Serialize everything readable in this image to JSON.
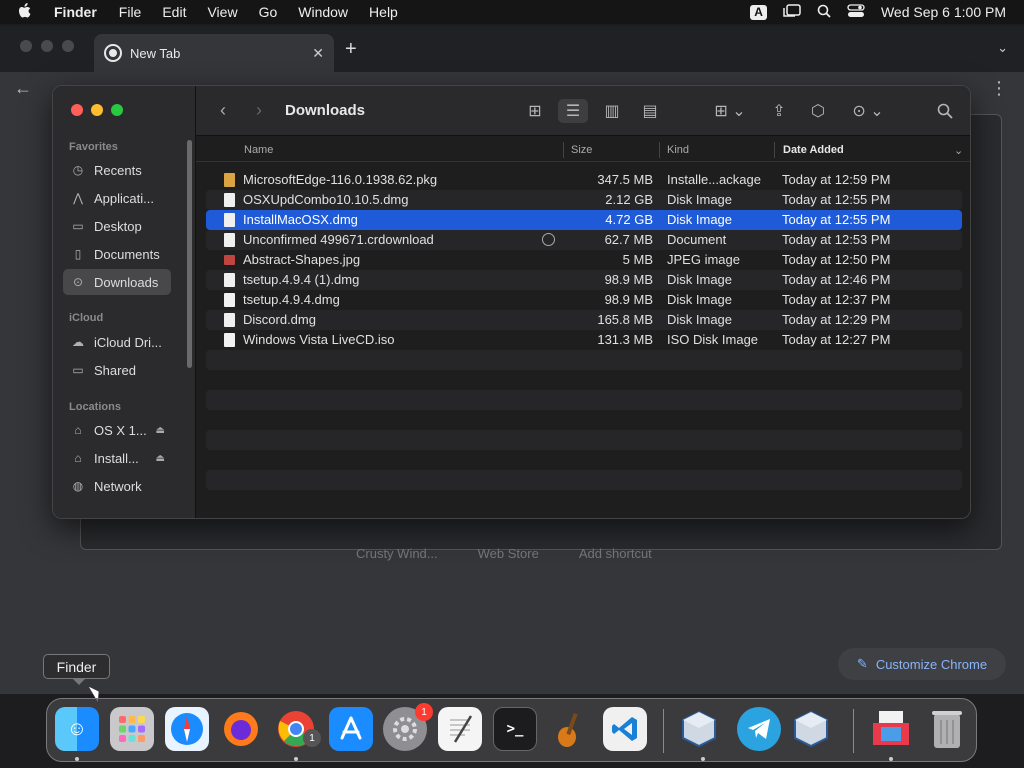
{
  "menubar": {
    "app": "Finder",
    "items": [
      "File",
      "Edit",
      "View",
      "Go",
      "Window",
      "Help"
    ],
    "input_source": "A",
    "datetime": "Wed Sep 6  1:00 PM"
  },
  "chrome": {
    "tab_title": "New Tab",
    "shortcuts": [
      "Crusty Wind...",
      "Web Store",
      "Add shortcut"
    ],
    "customize_label": "Customize Chrome"
  },
  "finder": {
    "title": "Downloads",
    "sidebar": {
      "favorites_label": "Favorites",
      "favorites": [
        {
          "label": "Recents",
          "icon": "clock-icon"
        },
        {
          "label": "Applicati...",
          "icon": "applications-icon"
        },
        {
          "label": "Desktop",
          "icon": "desktop-icon"
        },
        {
          "label": "Documents",
          "icon": "document-icon"
        },
        {
          "label": "Downloads",
          "icon": "download-icon"
        }
      ],
      "icloud_label": "iCloud",
      "icloud": [
        {
          "label": "iCloud Dri...",
          "icon": "cloud-icon"
        },
        {
          "label": "Shared",
          "icon": "shared-folder-icon"
        }
      ],
      "locations_label": "Locations",
      "locations": [
        {
          "label": "OS X 1...",
          "icon": "disk-icon"
        },
        {
          "label": "Install...",
          "icon": "disk-icon"
        },
        {
          "label": "Network",
          "icon": "globe-icon"
        }
      ]
    },
    "columns": {
      "name": "Name",
      "size": "Size",
      "kind": "Kind",
      "date": "Date Added"
    },
    "files": [
      {
        "name": "MicrosoftEdge-116.0.1938.62.pkg",
        "size": "347.5 MB",
        "kind": "Installe...ackage",
        "date": "Today at 12:59 PM",
        "icon": "pkg"
      },
      {
        "name": "OSXUpdCombo10.10.5.dmg",
        "size": "2.12 GB",
        "kind": "Disk Image",
        "date": "Today at 12:55 PM",
        "icon": "doc"
      },
      {
        "name": "InstallMacOSX.dmg",
        "size": "4.72 GB",
        "kind": "Disk Image",
        "date": "Today at 12:55 PM",
        "icon": "doc"
      },
      {
        "name": "Unconfirmed 499671.crdownload",
        "size": "62.7 MB",
        "kind": "Document",
        "date": "Today at 12:53 PM",
        "icon": "doc"
      },
      {
        "name": "Abstract-Shapes.jpg",
        "size": "5 MB",
        "kind": "JPEG image",
        "date": "Today at 12:50 PM",
        "icon": "img"
      },
      {
        "name": "tsetup.4.9.4 (1).dmg",
        "size": "98.9 MB",
        "kind": "Disk Image",
        "date": "Today at 12:46 PM",
        "icon": "doc"
      },
      {
        "name": "tsetup.4.9.4.dmg",
        "size": "98.9 MB",
        "kind": "Disk Image",
        "date": "Today at 12:37 PM",
        "icon": "doc"
      },
      {
        "name": "Discord.dmg",
        "size": "165.8 MB",
        "kind": "Disk Image",
        "date": "Today at 12:29 PM",
        "icon": "doc"
      },
      {
        "name": "Windows Vista LiveCD.iso",
        "size": "131.3 MB",
        "kind": "ISO Disk Image",
        "date": "Today at 12:27 PM",
        "icon": "doc"
      }
    ],
    "selected_index": 2
  },
  "tooltip": "Finder",
  "dock": {
    "system_preferences_badge": "1",
    "chrome_badge": "1"
  }
}
